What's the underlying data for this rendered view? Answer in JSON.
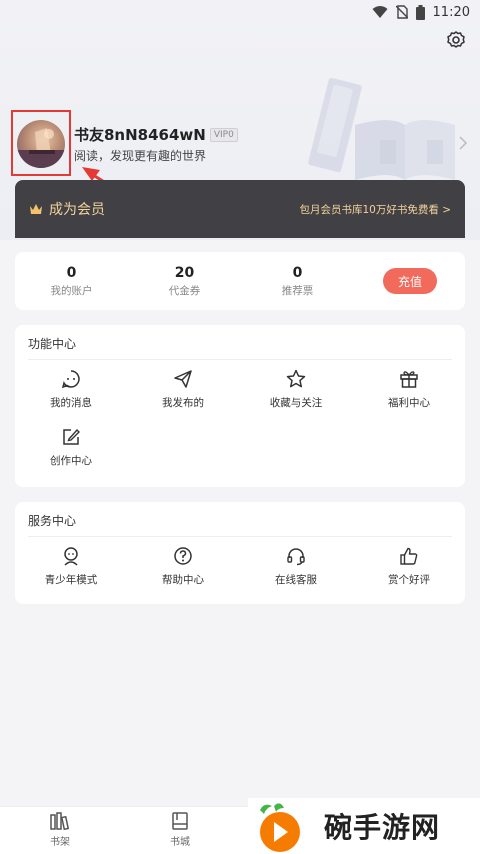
{
  "status_bar": {
    "time": "11:20"
  },
  "user": {
    "name": "书友8nN8464wN",
    "vip_level": "VIP0",
    "tagline": "阅读，发现更有趣的世界"
  },
  "vip_banner": {
    "title": "成为会员",
    "promo": "包月会员书库10万好书免费看 >"
  },
  "wallet": {
    "items": [
      {
        "value": "0",
        "label": "我的账户"
      },
      {
        "value": "20",
        "label": "代金券"
      },
      {
        "value": "0",
        "label": "推荐票"
      }
    ],
    "recharge_label": "充值"
  },
  "functions": {
    "title": "功能中心",
    "items": [
      {
        "icon": "message-icon",
        "label": "我的消息"
      },
      {
        "icon": "paper-plane-icon",
        "label": "我发布的"
      },
      {
        "icon": "star-icon",
        "label": "收藏与关注"
      },
      {
        "icon": "gift-icon",
        "label": "福利中心"
      },
      {
        "icon": "edit-icon",
        "label": "创作中心"
      }
    ]
  },
  "services": {
    "title": "服务中心",
    "items": [
      {
        "icon": "teen-mode-icon",
        "label": "青少年模式"
      },
      {
        "icon": "help-icon",
        "label": "帮助中心"
      },
      {
        "icon": "headset-icon",
        "label": "在线客服"
      },
      {
        "icon": "thumbs-up-icon",
        "label": "赏个好评"
      }
    ]
  },
  "bottom_nav": {
    "items": [
      {
        "icon": "bookshelf-icon",
        "label": "书架"
      },
      {
        "icon": "bookstore-icon",
        "label": "书城"
      }
    ]
  },
  "watermark": {
    "text": "碗手游网"
  },
  "colors": {
    "accent": "#f26a5b",
    "vip_gold": "#f3d29b",
    "banner_bg": "#414145",
    "highlight": "#e53935"
  }
}
